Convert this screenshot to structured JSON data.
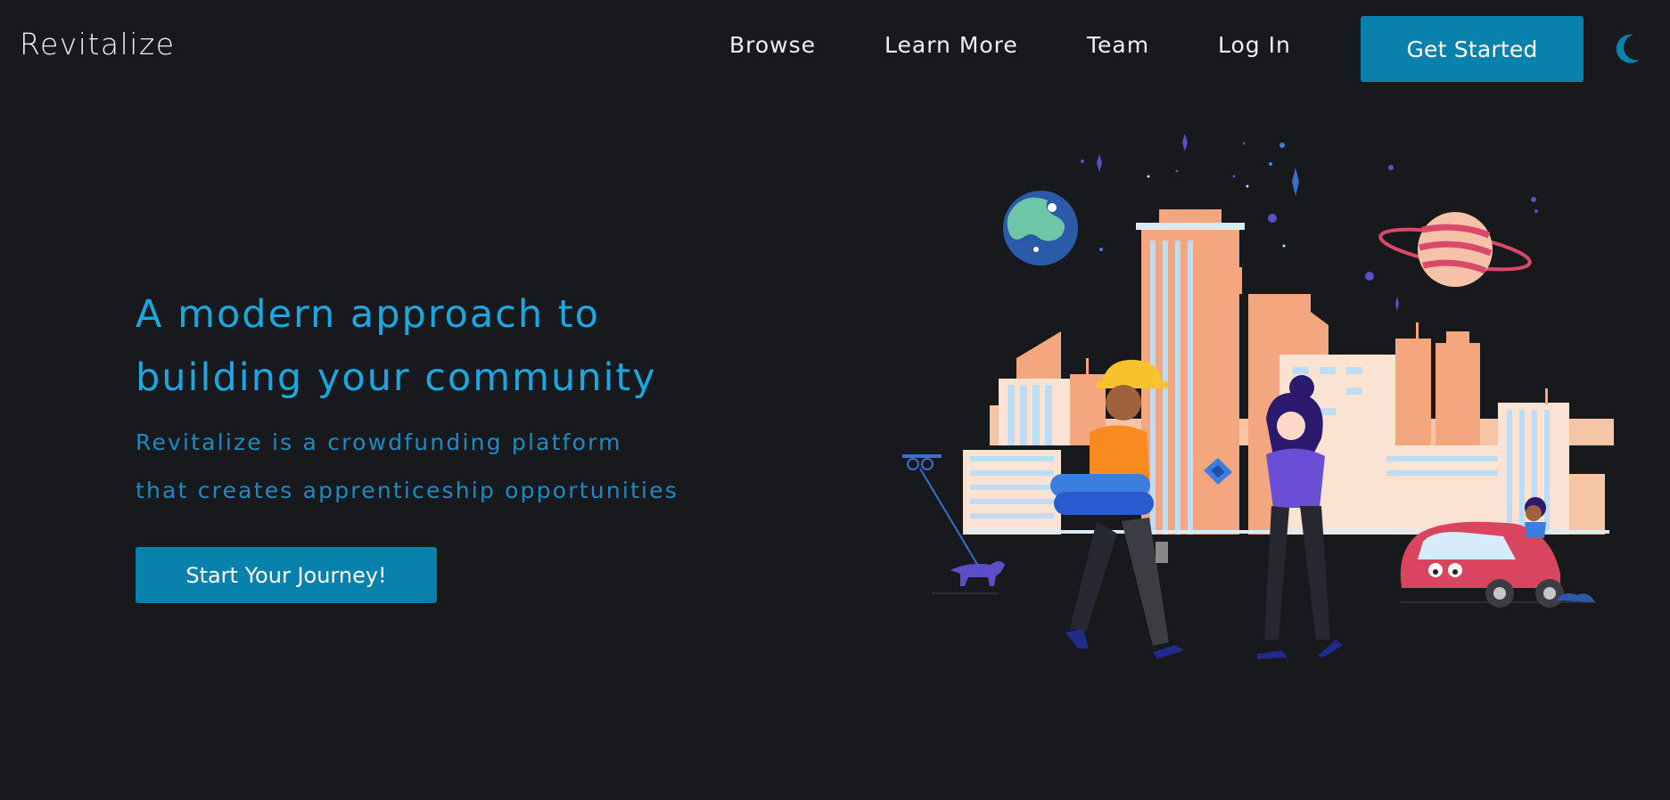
{
  "header": {
    "brand": "Revitalize",
    "nav": {
      "browse": "Browse",
      "learn_more": "Learn More",
      "team": "Team",
      "log_in": "Log In"
    },
    "get_started_label": "Get Started",
    "theme_toggle_icon": "moon-icon"
  },
  "hero": {
    "title_line1": "A modern approach to",
    "title_line2": "building your community",
    "subtitle_line1": "Revitalize is a crowdfunding platform",
    "subtitle_line2": "that creates apprenticeship opportunities",
    "cta_label": "Start Your Journey!"
  },
  "illustration": {
    "icon": "city-community-illustration"
  },
  "colors": {
    "background": "#18191d",
    "accent": "#0882ad",
    "title": "#1ba8e0",
    "subtitle": "#1a8cc4",
    "nav_text": "#f0f0f0"
  }
}
